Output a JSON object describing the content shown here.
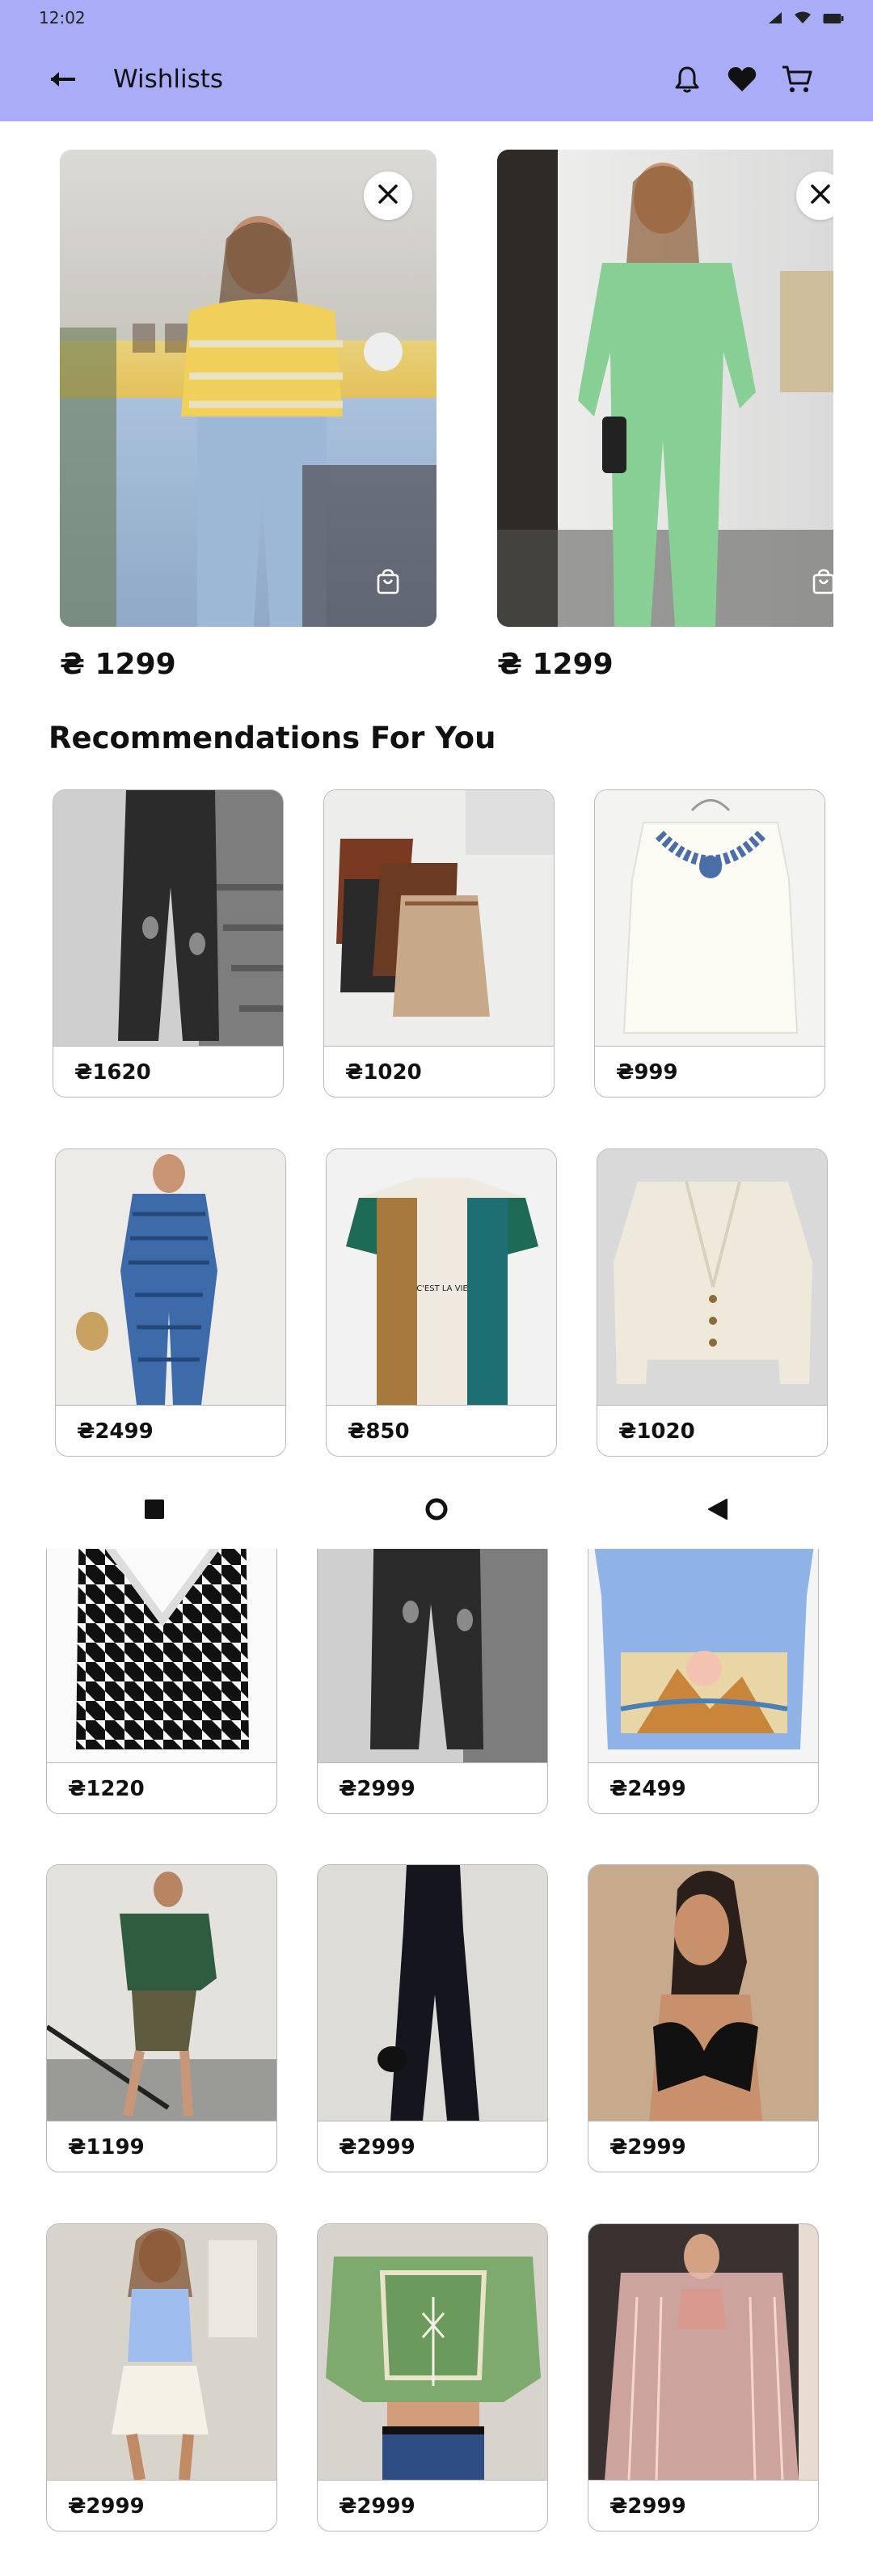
{
  "status_bar": {
    "time": "12:02"
  },
  "header": {
    "title": "Wishlists"
  },
  "wishlist": [
    {
      "price": "₴ 1299",
      "image": "yellow-striped-sweater-jeans"
    },
    {
      "price": "₴ 1299",
      "image": "green-suit"
    }
  ],
  "section_title": "Recommendations For You",
  "products": [
    {
      "price": "₴1620",
      "image": "black-ripped-jeans"
    },
    {
      "price": "₴1020",
      "image": "skirts-with-belts"
    },
    {
      "price": "₴999",
      "image": "white-embroidered-top"
    },
    {
      "price": "₴2499",
      "image": "blue-check-jumpsuit"
    },
    {
      "price": "₴850",
      "image": "cest-la-vie-tshirt"
    },
    {
      "price": "₴1020",
      "image": "cream-cardigan"
    },
    {
      "price": "₴1220",
      "image": "houndstooth-vest"
    },
    {
      "price": "₴2999",
      "image": "black-ripped-jeans"
    },
    {
      "price": "₴2499",
      "image": "printed-tshirt-dress"
    },
    {
      "price": "₴1199",
      "image": "green-blouse-sequin-skirt"
    },
    {
      "price": "₴2999",
      "image": "black-jumpsuit"
    },
    {
      "price": "₴2999",
      "image": "black-bow-top"
    },
    {
      "price": "₴2999",
      "image": "blue-top-white-shorts"
    },
    {
      "price": "₴2999",
      "image": "green-knit-crop-top"
    },
    {
      "price": "₴2999",
      "image": "pink-fringe-kimono"
    }
  ],
  "colors": {
    "app_bar": "#a9acf7",
    "card_border": "#b9b9b9",
    "text": "#111111"
  }
}
